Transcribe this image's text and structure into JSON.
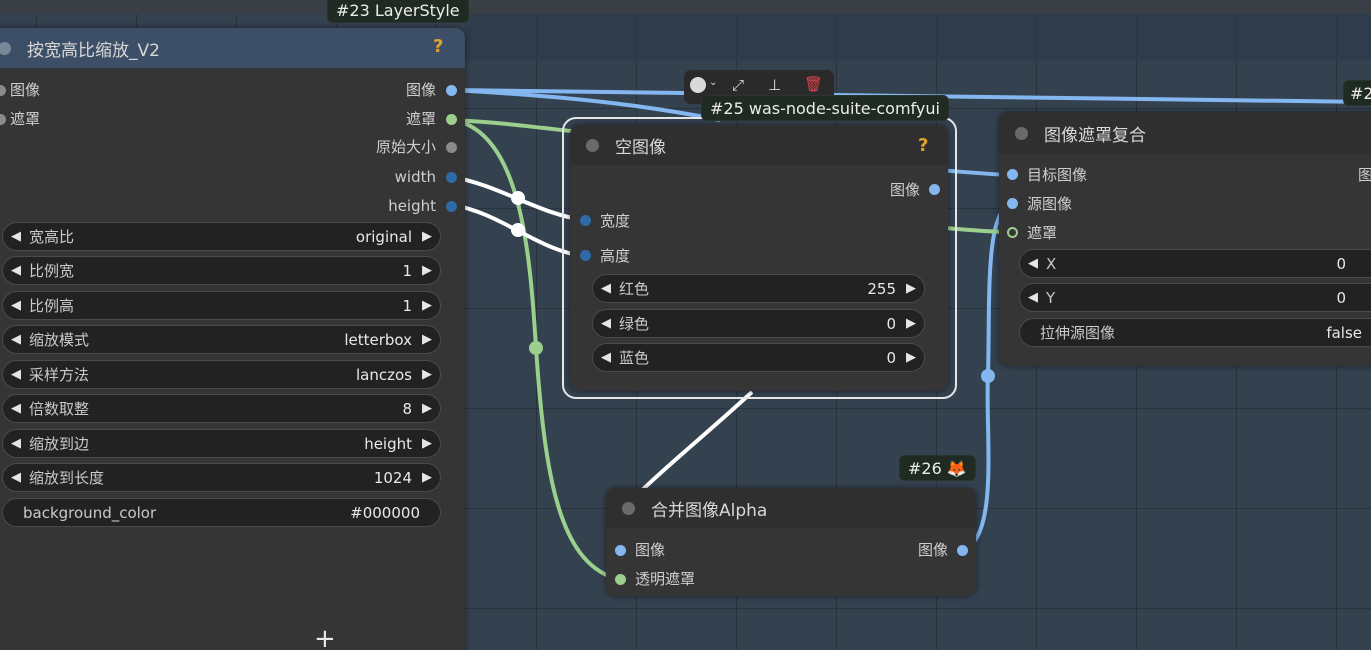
{
  "layer_tag": "#23 LayerStyle",
  "was_tag": "#25 was-node-suite-comfyui",
  "n26_tag": "#26 🦊",
  "edge_tag": "#2",
  "node_scale": {
    "title": "按宽高比缩放_V2",
    "help": "?",
    "inputs": [
      "图像",
      "遮罩"
    ],
    "outputs": [
      "图像",
      "遮罩",
      "原始大小",
      "width",
      "height"
    ],
    "widgets": [
      {
        "label": "宽高比",
        "value": "original"
      },
      {
        "label": "比例宽",
        "value": "1"
      },
      {
        "label": "比例高",
        "value": "1"
      },
      {
        "label": "缩放模式",
        "value": "letterbox"
      },
      {
        "label": "采样方法",
        "value": "lanczos"
      },
      {
        "label": "倍数取整",
        "value": "8"
      },
      {
        "label": "缩放到边",
        "value": "height"
      },
      {
        "label": "缩放到长度",
        "value": "1024"
      }
    ],
    "bg_widget": {
      "label": "background_color",
      "value": "#000000"
    }
  },
  "node_empty": {
    "title": "空图像",
    "help": "?",
    "output": "图像",
    "inputs": [
      "宽度",
      "高度"
    ],
    "widgets": [
      {
        "label": "红色",
        "value": "255"
      },
      {
        "label": "绿色",
        "value": "0"
      },
      {
        "label": "蓝色",
        "value": "0"
      }
    ]
  },
  "node_composite": {
    "title": "图像遮罩复合",
    "output": "图",
    "inputs": [
      "目标图像",
      "源图像",
      "遮罩"
    ],
    "widgets": [
      {
        "label": "X",
        "value": "0"
      },
      {
        "label": "Y",
        "value": "0"
      }
    ],
    "toggle": {
      "label": "拉伸源图像",
      "value": "false"
    }
  },
  "node_alpha": {
    "title": "合并图像Alpha",
    "inputs": [
      "图像",
      "透明遮罩"
    ],
    "output": "图像"
  },
  "toolbar": {
    "icons": [
      "color-picker-icon",
      "bypass-icon",
      "pin-icon",
      "trash-icon"
    ]
  },
  "colors": {
    "canvas": "#34414f",
    "node_body": "#353535",
    "node_header": "#2f2f2f",
    "image_wire": "#84b7f0",
    "mask_wire": "#9acf8e",
    "int_wire": "#ffffff",
    "help": "#e0a330",
    "delete": "#e0454a"
  }
}
